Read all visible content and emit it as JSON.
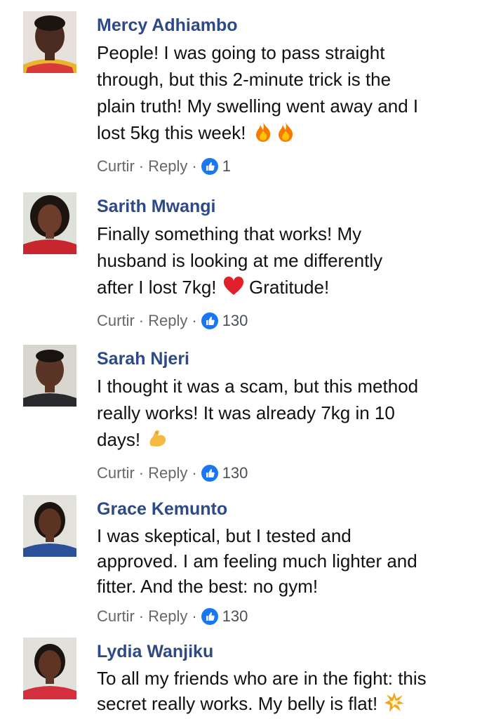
{
  "comments": [
    {
      "name": "Mercy Adhiambo",
      "lines": [
        "People! I was going to pass straight",
        "through, but this 2-minute trick is the",
        "plain truth! My swelling went away and I",
        "lost 5kg this week!"
      ],
      "emoji": "fire-fire",
      "like_label": "Curtir",
      "reply_label": "Reply",
      "reactions": "1"
    },
    {
      "name": "Sarith Mwangi",
      "lines": [
        "Finally something that works! My",
        "husband is looking at me differently",
        "after I lost 7kg!",
        "Gratitude!"
      ],
      "emoji": "red-heart",
      "like_label": "Curtir",
      "reply_label": "Reply",
      "reactions": "130"
    },
    {
      "name": "Sarah Njeri",
      "lines": [
        "I thought it was a scam, but this method",
        "really works! It was already 7kg in 10",
        "days!"
      ],
      "emoji": "flexed-biceps",
      "like_label": "Curtir",
      "reply_label": "Reply",
      "reactions": "130"
    },
    {
      "name": "Grace Kemunto",
      "lines": [
        "I was skeptical, but I tested and",
        "approved. I am feeling much lighter and",
        "fitter. And the best: no gym!"
      ],
      "like_label": "Curtir",
      "reply_label": "Reply",
      "reactions": "130"
    },
    {
      "name": "Lydia Wanjiku",
      "lines": [
        "To all my friends who are in the fight: this",
        "secret really works. My belly is flat!"
      ],
      "emoji": "collision"
    }
  ],
  "colors": {
    "name": "#2d4a86",
    "meta": "#65676b",
    "like_blue": "#1877f2"
  },
  "icons": [
    "like-thumb-icon",
    "fire-icon",
    "heart-icon",
    "biceps-icon",
    "collision-icon"
  ]
}
